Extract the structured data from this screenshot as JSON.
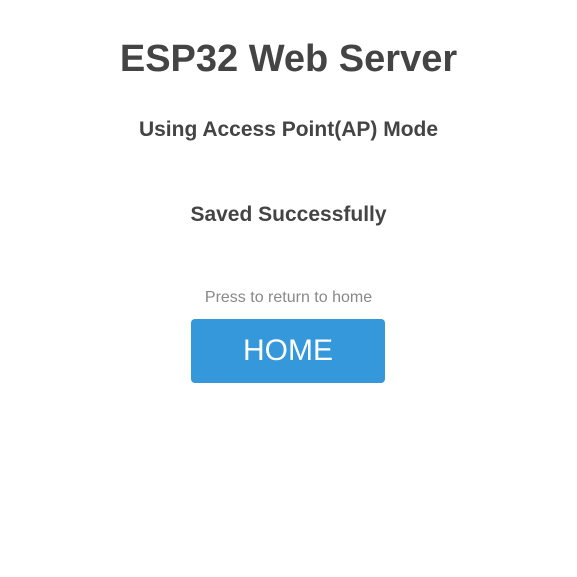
{
  "header": {
    "title": "ESP32 Web Server",
    "subtitle": "Using Access Point(AP) Mode"
  },
  "main": {
    "status_message": "Saved Successfully",
    "hint_text": "Press to return to home",
    "home_button_label": "HOME"
  },
  "colors": {
    "text": "#444444",
    "hint_text": "#888888",
    "button_background": "#3498db",
    "button_text": "#ffffff",
    "page_background": "#ffffff"
  }
}
